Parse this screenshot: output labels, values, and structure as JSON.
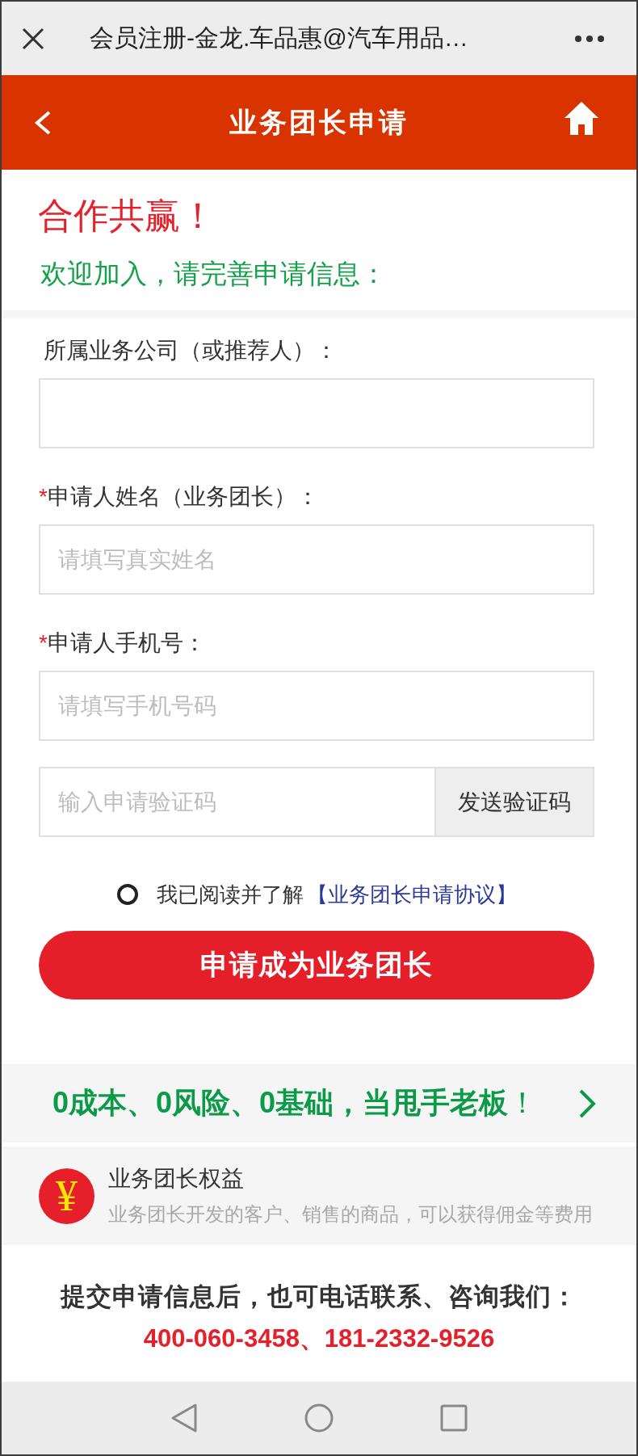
{
  "browser_bar": {
    "title": "会员注册-金龙.车品惠@汽车用品…"
  },
  "header": {
    "title": "业务团长申请"
  },
  "intro": {
    "headline": "合作共赢！",
    "subtitle": "欢迎加入，请完善申请信息："
  },
  "form": {
    "fields": [
      {
        "kind": "text",
        "label": "所属业务公司（或推荐人）："
      },
      {
        "kind": "text",
        "marker": "*",
        "label": "申请人姓名（业务团长）：",
        "placeholder": "请填写真实姓名"
      },
      {
        "kind": "text",
        "marker": "*",
        "label": "申请人手机号：",
        "placeholder": "请填写手机号码"
      },
      {
        "kind": "code",
        "placeholder": "输入申请验证码",
        "button": "发送验证码"
      }
    ],
    "agreement": {
      "checked": false,
      "text": "我已阅读并了解",
      "link": "【业务团长申请协议】"
    },
    "submit_button": "申请成为业务团长"
  },
  "promo_banner": {
    "text": "**0成本、0风险、0基础，当甩手老板**！"
  },
  "benefit": {
    "symbol": "¥",
    "title": "业务团长权益",
    "description": "业务团长开发的客户、销售的商品，可以获得佣金等费用"
  },
  "contact": {
    "prompt": "提交申请信息后，也可电话联系、咨询我们：",
    "phones": "400-060-3458、181-2332-9526"
  }
}
